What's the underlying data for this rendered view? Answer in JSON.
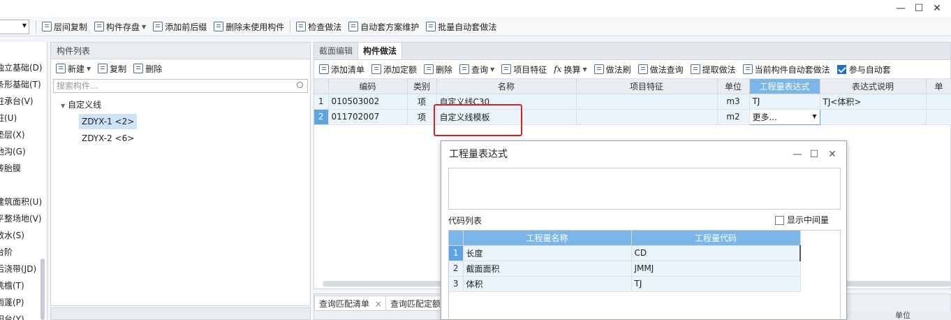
{
  "window": {
    "controls": [
      "—",
      "☐",
      "✕"
    ]
  },
  "main_toolbar": {
    "items": [
      "层间复制",
      "构件存盘",
      "添加前后缀",
      "删除未使用构件",
      "检查做法",
      "自动套方案维护",
      "批量自动套做法"
    ]
  },
  "left_nav": {
    "items": [
      "独立基础(D)",
      "条形基础(T)",
      "桩承台(V)",
      "桩(U)",
      "垫层(X)",
      "地沟(G)",
      "砖胎膜",
      "",
      "建筑面积(U)",
      "平整场地(V)",
      "散水(S)",
      "台阶",
      "后浇带(JD)",
      "挑檐(T)",
      "雨蓬(P)",
      "阳台(Y)"
    ]
  },
  "component_list": {
    "header": "构件列表",
    "toolbar": {
      "new": "新建",
      "copy": "复制",
      "delete": "删除"
    },
    "search_placeholder": "搜索构件...",
    "tree": {
      "root": "自定义线",
      "children": [
        "ZDYX-1 <2>",
        "ZDYX-2 <6>"
      ]
    }
  },
  "right_panel": {
    "tabs": [
      "截面编辑",
      "构件做法"
    ],
    "active_tab": "构件做法",
    "toolbar": {
      "add_list": "添加清单",
      "add_quota": "添加定额",
      "delete": "删除",
      "query": "查询",
      "item_features": "项目特征",
      "convert": "换算",
      "method_brush": "做法刷",
      "method_query": "做法查询",
      "extract_method": "提取做法",
      "auto_match_current": "当前构件自动套做法",
      "participate_auto": "参与自动套"
    },
    "grid": {
      "columns": [
        "编码",
        "类别",
        "名称",
        "项目特征",
        "单位",
        "工程量表达式",
        "表达式说明",
        "单"
      ],
      "rows": [
        {
          "no": "1",
          "code": "010503002",
          "type": "项",
          "name": "自定义线C30",
          "features": "",
          "unit": "m3",
          "expr": "TJ",
          "expr_desc": "TJ<体积>"
        },
        {
          "no": "2",
          "code": "011702007",
          "type": "项",
          "name": "自定义线模板",
          "features": "",
          "unit": "m2",
          "expr": "更多...",
          "expr_desc": ""
        }
      ]
    }
  },
  "bottom_tabs": [
    "查询匹配清单",
    "查询匹配定额"
  ],
  "bottom_right_header": "单位",
  "dialog": {
    "title": "工程量表达式",
    "code_list_label": "代码列表",
    "show_intermediate": "显示中间量",
    "columns": [
      "工程量名称",
      "工程量代码"
    ],
    "rows": [
      {
        "no": "1",
        "name": "长度",
        "code": "CD"
      },
      {
        "no": "2",
        "name": "截面面积",
        "code": "JMMJ"
      },
      {
        "no": "3",
        "name": "体积",
        "code": "TJ"
      }
    ]
  },
  "colors": {
    "highlight_header": "#7ab6e8",
    "selected_row_num": "#5ea4e0",
    "row_bg": "#eaf4fd",
    "annotation_red": "#e0201c"
  }
}
